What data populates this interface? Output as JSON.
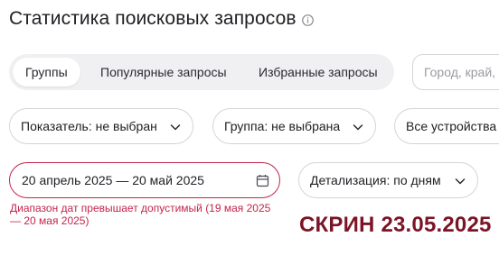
{
  "page": {
    "title": "Статистика поисковых запросов",
    "title_icon": "info-icon"
  },
  "tabs": [
    {
      "label": "Группы",
      "active": true
    },
    {
      "label": "Популярные запросы",
      "active": false
    },
    {
      "label": "Избранные запросы",
      "active": false
    }
  ],
  "search": {
    "placeholder": "Город, край, область",
    "value": ""
  },
  "filters": {
    "metric": "Показатель: не выбран",
    "group": "Группа: не выбрана",
    "devices": "Все устройства"
  },
  "date_range": {
    "value": "20 апрель 2025 — 20 май 2025",
    "error": "Диапазон дат превышает допустимый (19 мая 2025 — 20 мая 2025)",
    "icon": "calendar-icon"
  },
  "detail": {
    "label": "Детализация: по дням"
  },
  "stamp": {
    "text": "СКРИН 23.05.2025"
  },
  "colors": {
    "error": "#c4244b",
    "stamp": "#7b1426",
    "tabs_bg": "#f0f0f3",
    "border": "#d5d5da"
  }
}
